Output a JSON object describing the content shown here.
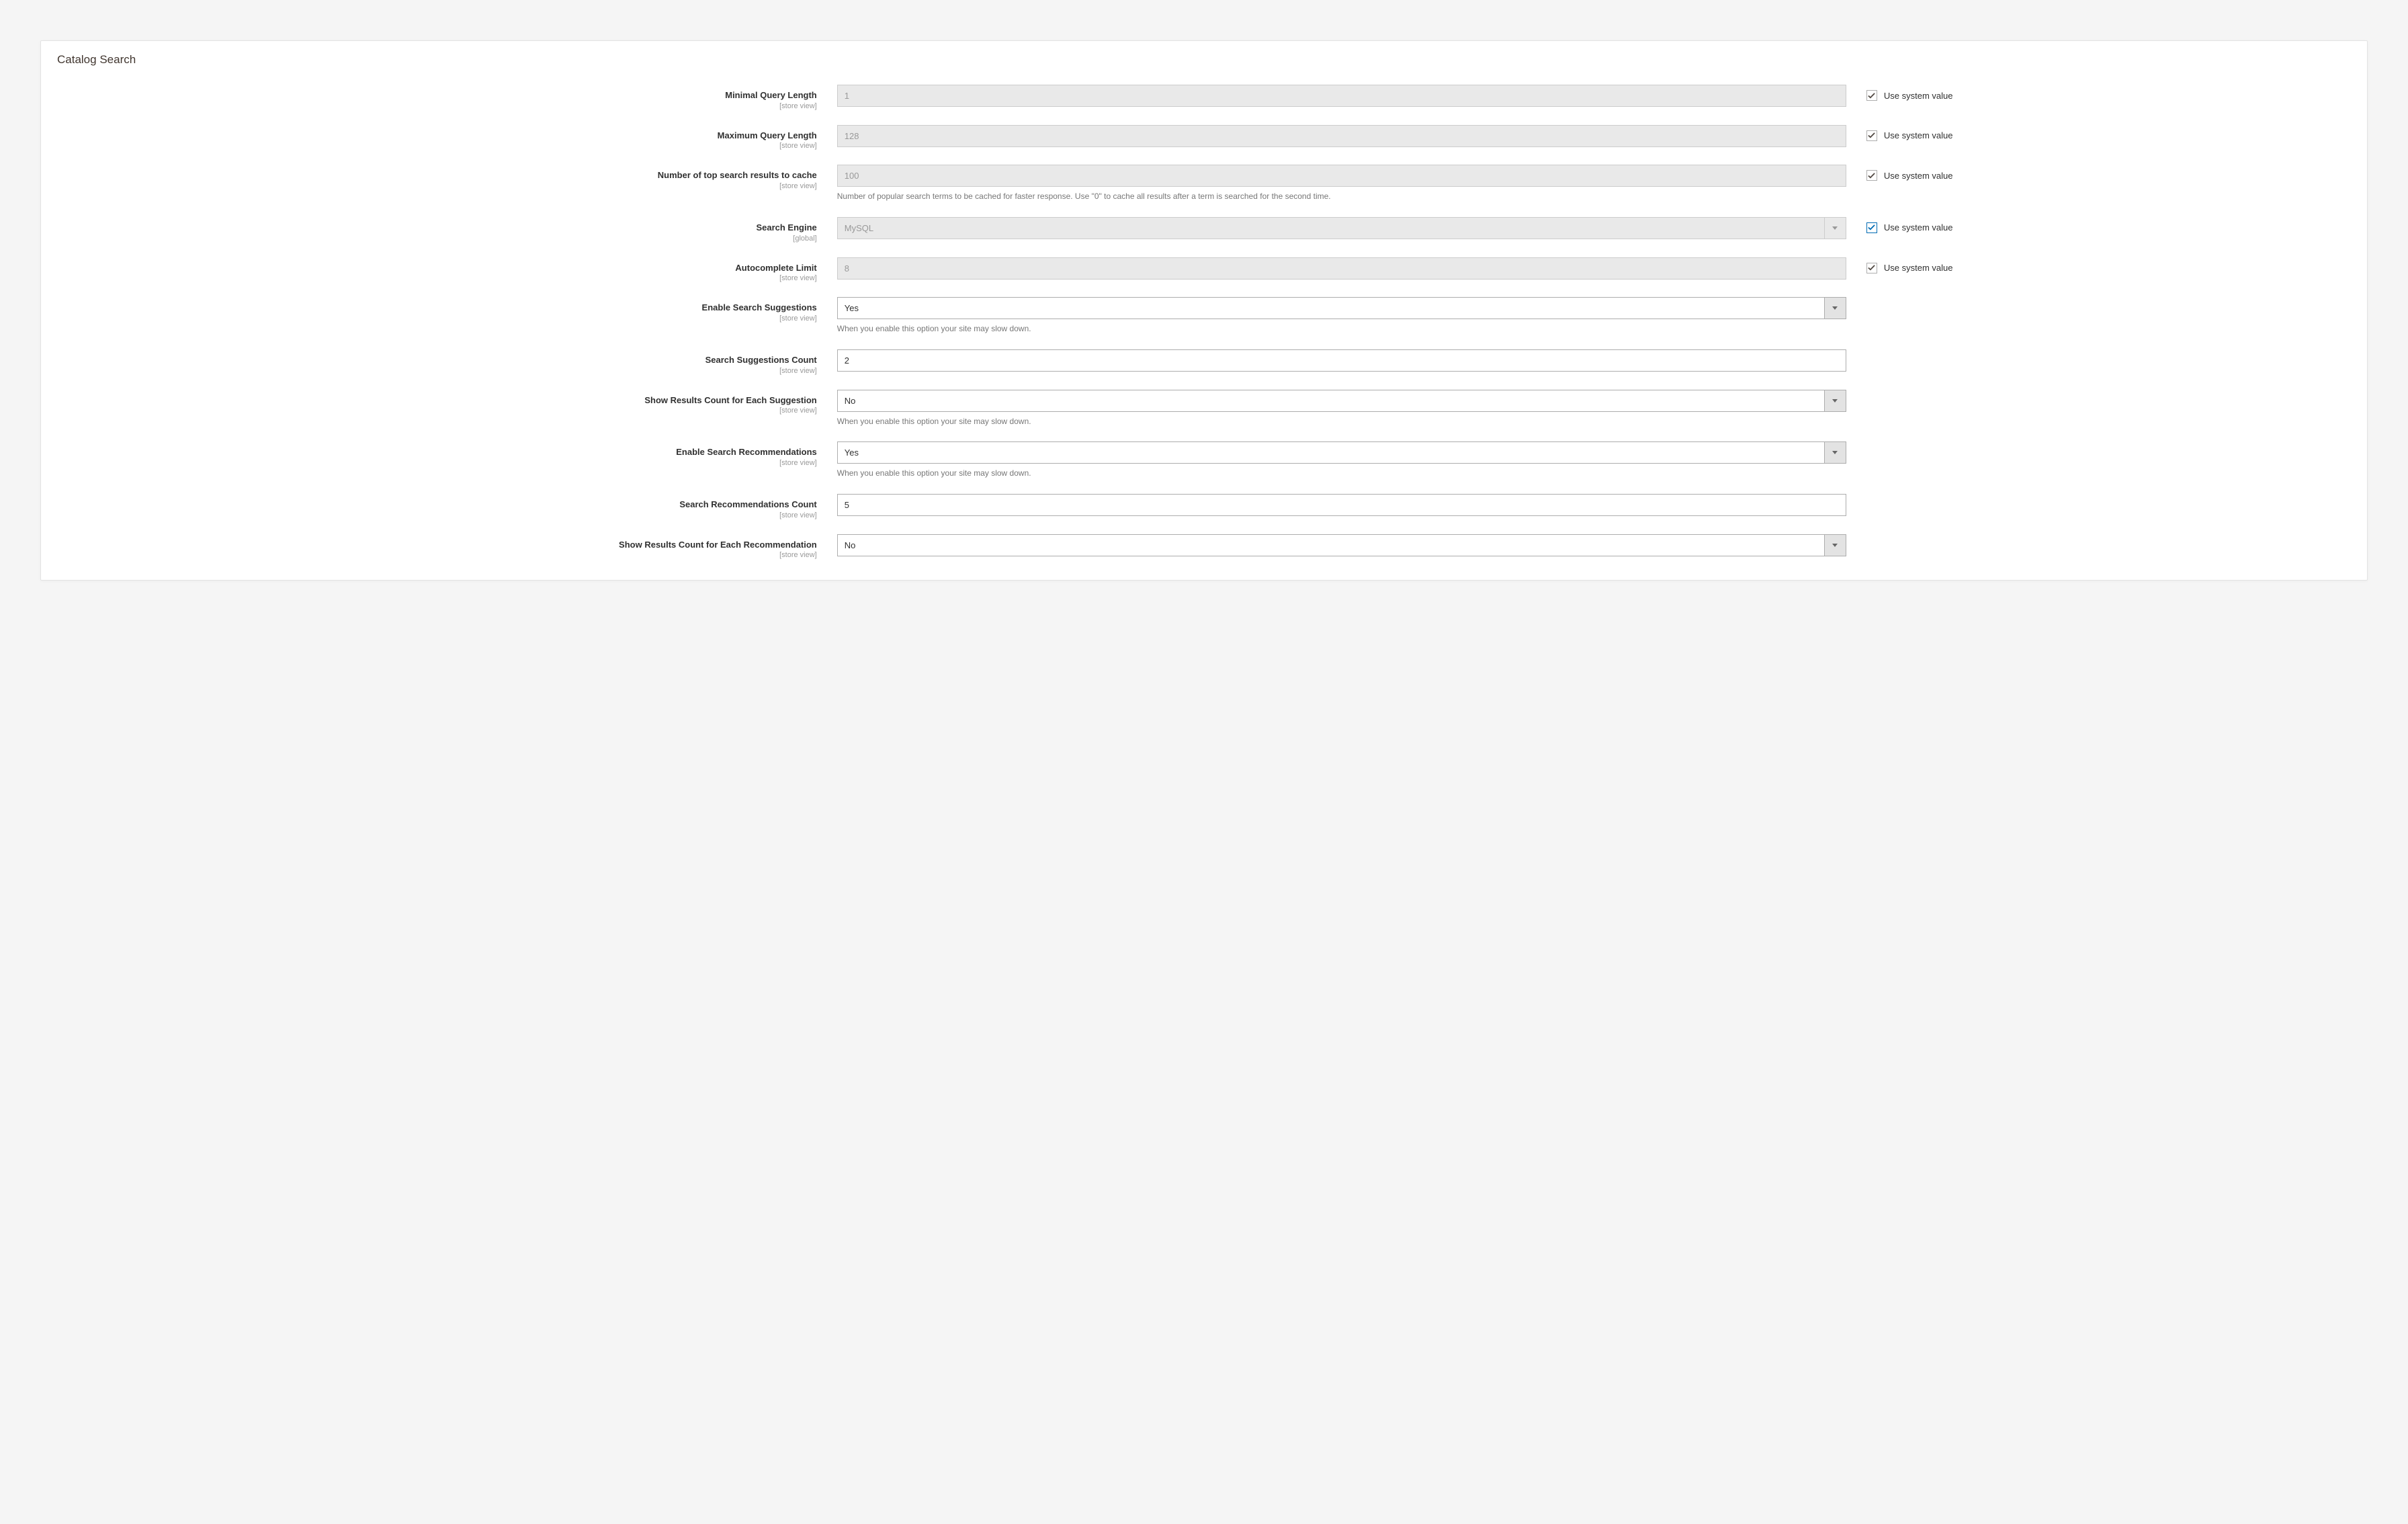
{
  "panel": {
    "title": "Catalog Search"
  },
  "common": {
    "use_system_value": "Use system value",
    "scope_store": "[store view]",
    "scope_global": "[global]"
  },
  "fields": {
    "min_query": {
      "label": "Minimal Query Length",
      "scope": "[store view]",
      "value": "1",
      "disabled": true,
      "checkbox": true
    },
    "max_query": {
      "label": "Maximum Query Length",
      "scope": "[store view]",
      "value": "128",
      "disabled": true,
      "checkbox": true
    },
    "top_results_cache": {
      "label": "Number of top search results to cache",
      "scope": "[store view]",
      "value": "100",
      "disabled": true,
      "checkbox": true,
      "help": "Number of popular search terms to be cached for faster response. Use \"0\" to cache all results after a term is searched for the second time."
    },
    "search_engine": {
      "label": "Search Engine",
      "scope": "[global]",
      "value": "MySQL",
      "disabled": true,
      "checkbox": true,
      "checkbox_active": true
    },
    "autocomplete_limit": {
      "label": "Autocomplete Limit",
      "scope": "[store view]",
      "value": "8",
      "disabled": true,
      "checkbox": true
    },
    "enable_suggestions": {
      "label": "Enable Search Suggestions",
      "scope": "[store view]",
      "value": "Yes",
      "help": "When you enable this option your site may slow down."
    },
    "suggestions_count": {
      "label": "Search Suggestions Count",
      "scope": "[store view]",
      "value": "2"
    },
    "show_results_suggestion": {
      "label": "Show Results Count for Each Suggestion",
      "scope": "[store view]",
      "value": "No",
      "help": "When you enable this option your site may slow down."
    },
    "enable_recommendations": {
      "label": "Enable Search Recommendations",
      "scope": "[store view]",
      "value": "Yes",
      "help": "When you enable this option your site may slow down."
    },
    "recommendations_count": {
      "label": "Search Recommendations Count",
      "scope": "[store view]",
      "value": "5"
    },
    "show_results_recommendation": {
      "label": "Show Results Count for Each Recommendation",
      "scope": "[store view]",
      "value": "No"
    }
  }
}
